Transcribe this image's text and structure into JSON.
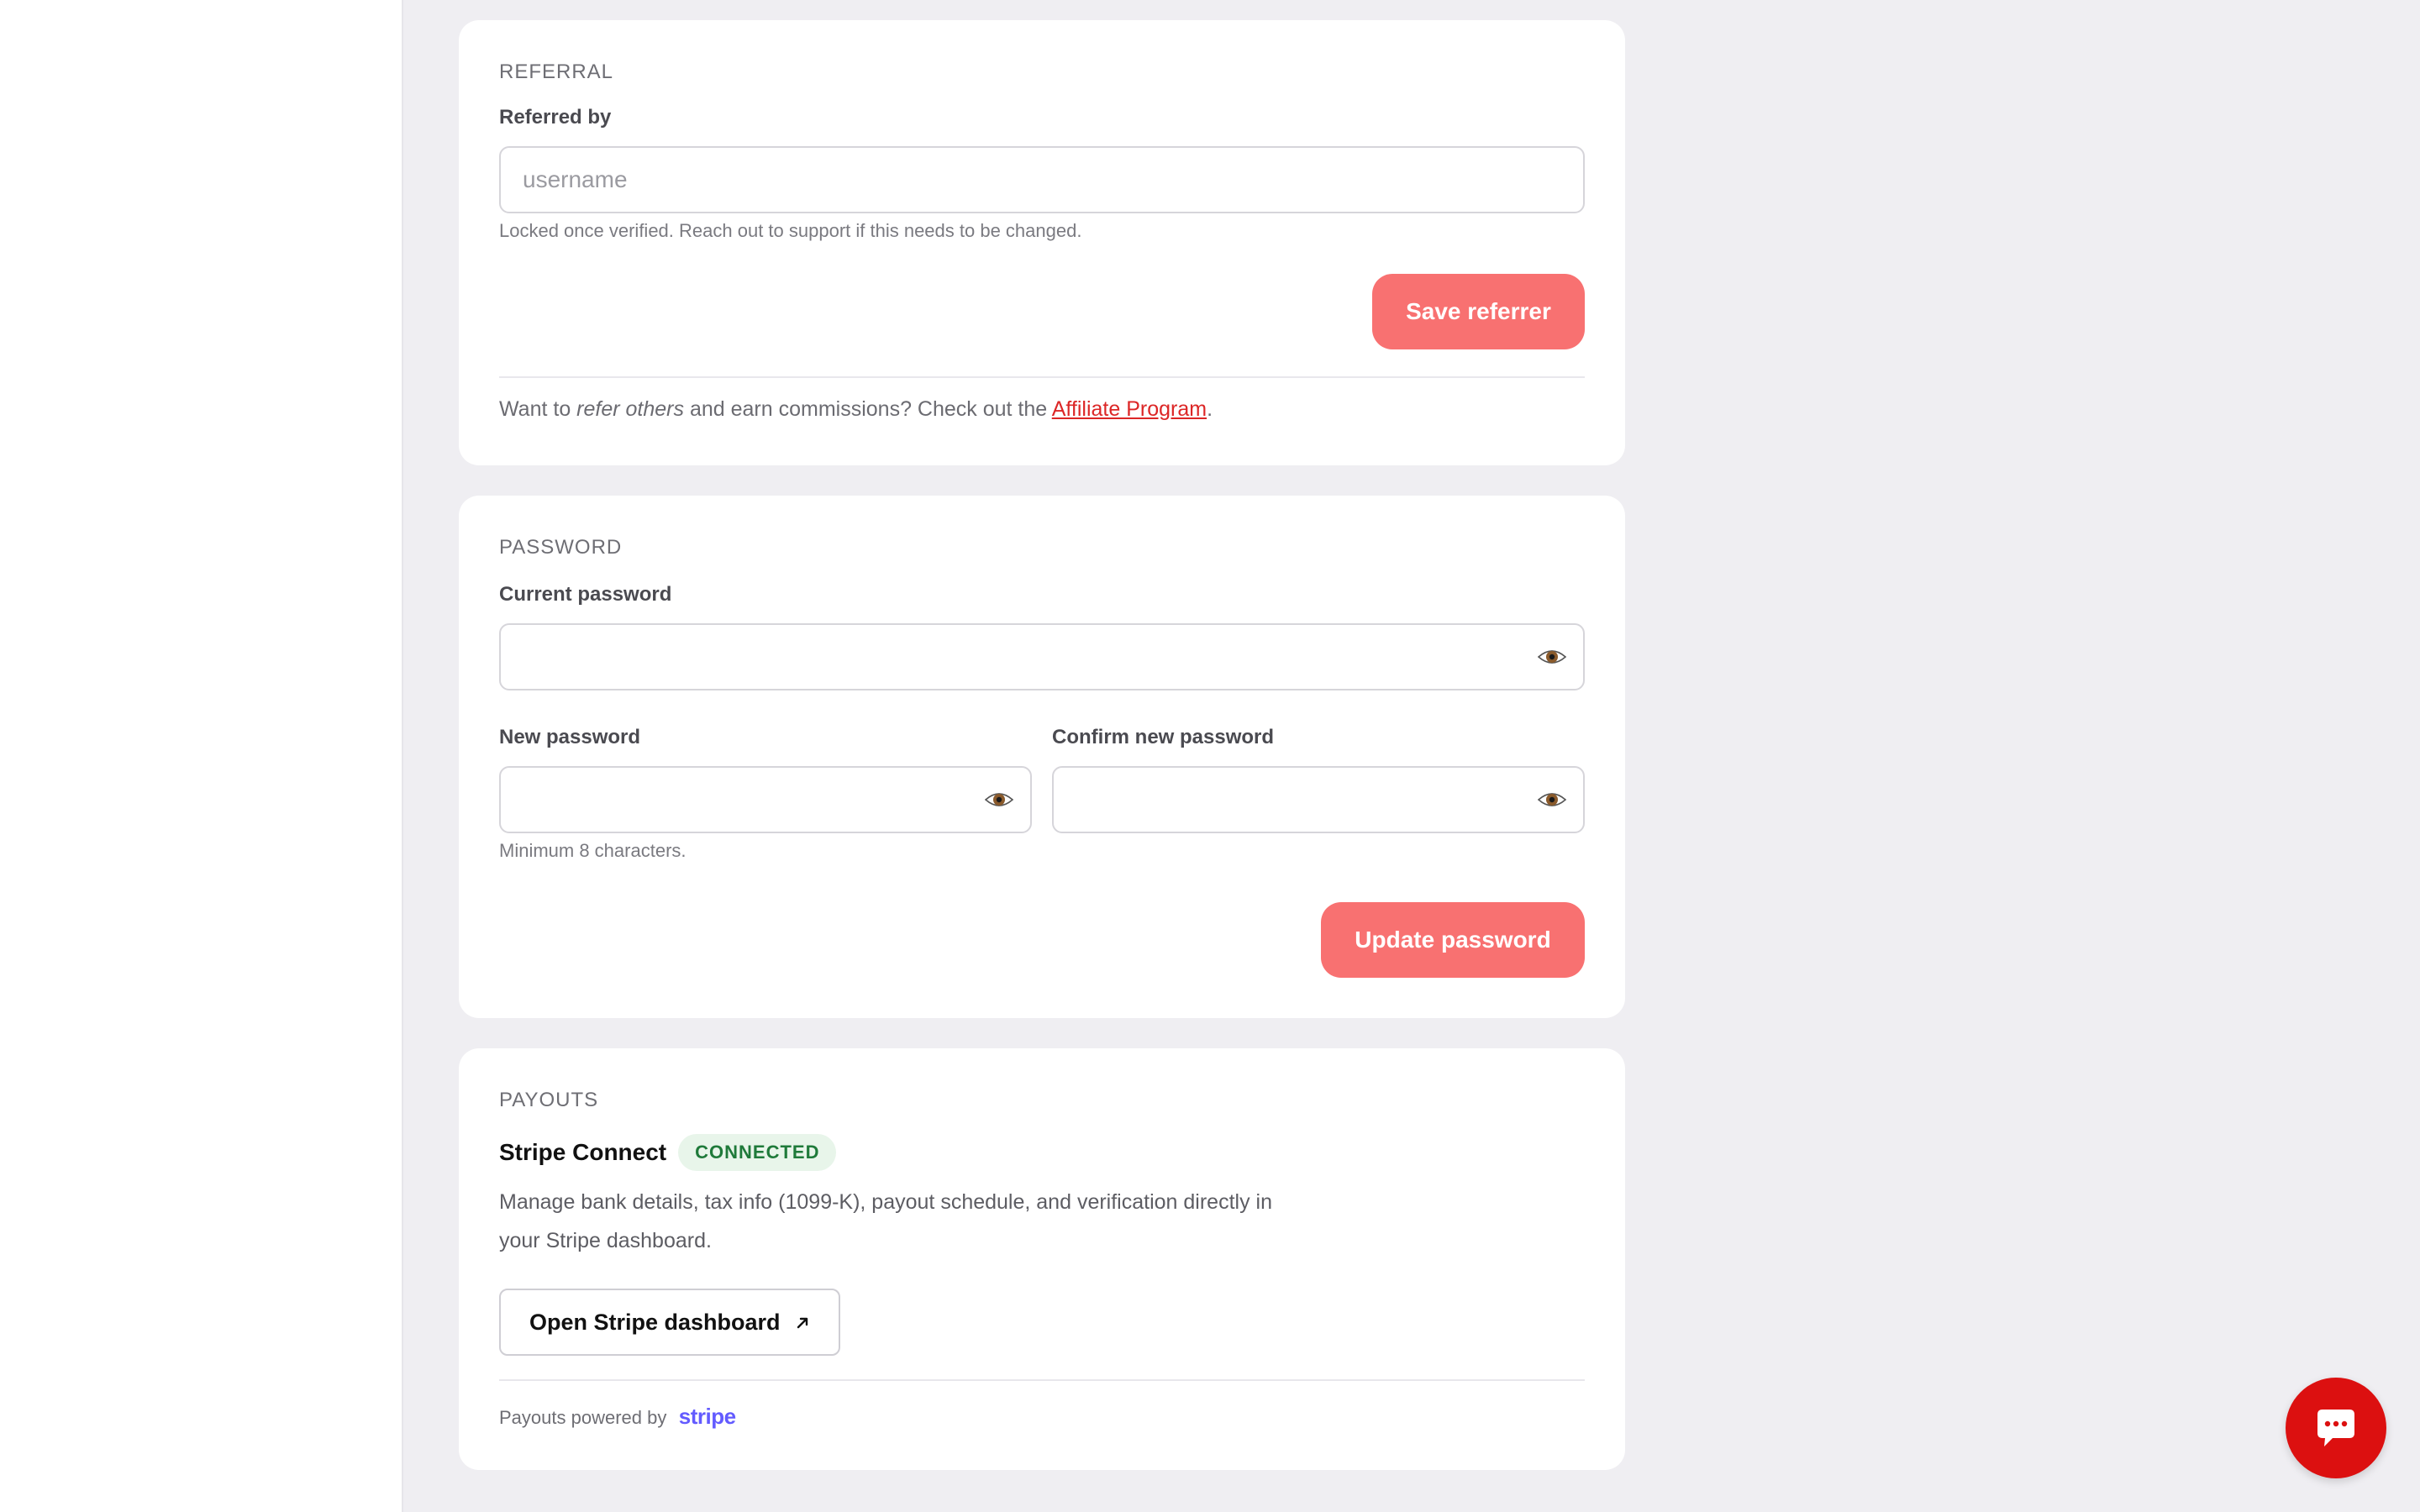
{
  "referral": {
    "section_title": "REFERRAL",
    "label": "Referred by",
    "placeholder": "username",
    "value": "",
    "help": "Locked once verified. Reach out to support if this needs to be changed.",
    "save_label": "Save referrer",
    "note_prefix": "Want to ",
    "note_emphasis": "refer others",
    "note_middle": " and earn commissions? Check out the ",
    "note_link": "Affiliate Program",
    "note_suffix": "."
  },
  "password": {
    "section_title": "PASSWORD",
    "current_label": "Current password",
    "new_label": "New password",
    "confirm_label": "Confirm new password",
    "help": "Minimum 8 characters.",
    "update_label": "Update password",
    "reveal_icon": "eye-icon"
  },
  "payouts": {
    "section_title": "PAYOUTS",
    "provider_name": "Stripe Connect",
    "status_badge": "CONNECTED",
    "description_line1": "Manage bank details, tax info (1099-K), payout schedule, and verification directly in",
    "description_line2": "your Stripe dashboard.",
    "dashboard_button": "Open Stripe dashboard",
    "dashboard_icon": "external-arrow-icon",
    "footer_text": "Payouts powered by",
    "stripe_logo": "stripe"
  },
  "chat": {
    "icon": "chat-bubble-icon"
  },
  "colors": {
    "accent": "#f87171",
    "link": "#dc2626",
    "chat": "#dc1010",
    "badge_bg": "#e8f5ea",
    "badge_text": "#1f7a3a",
    "stripe": "#635bff"
  }
}
